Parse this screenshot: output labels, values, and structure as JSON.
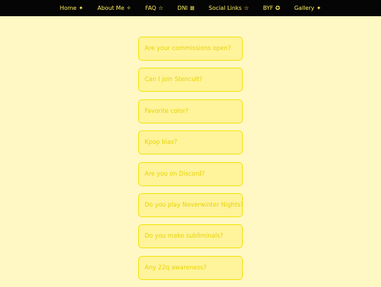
{
  "colors": {
    "background": "#fff8c4",
    "navbar": "#050505",
    "nav_text": "#fff060",
    "faq_border": "#f2e300",
    "faq_fill": "#fff39b",
    "faq_text": "#e6d400"
  },
  "nav": {
    "items": [
      {
        "label": "Home",
        "icon": "✦",
        "icon_name": "four-point-star-icon"
      },
      {
        "label": "About Me",
        "icon": "✧",
        "icon_name": "sparkle-icon"
      },
      {
        "label": "FAQ",
        "icon": "☆",
        "icon_name": "star-outline-icon"
      },
      {
        "label": "DNI",
        "icon": "⊠",
        "icon_name": "boxed-cross-icon"
      },
      {
        "label": "Social Links",
        "icon": "☆",
        "icon_name": "star-outline-icon"
      },
      {
        "label": "BYF",
        "icon": "✪",
        "icon_name": "circled-star-icon"
      },
      {
        "label": "Gallery",
        "icon": "✦",
        "icon_name": "four-point-star-icon"
      }
    ]
  },
  "faq": {
    "questions": [
      "Are your commissions open?",
      "Can I join Stencult?",
      "Favorite color?",
      "Kpop bias?",
      "Are you on Discord?",
      "Do you play Neverwinter Nights?",
      "Do you make subliminals?",
      "Any 22q awareness?"
    ]
  }
}
